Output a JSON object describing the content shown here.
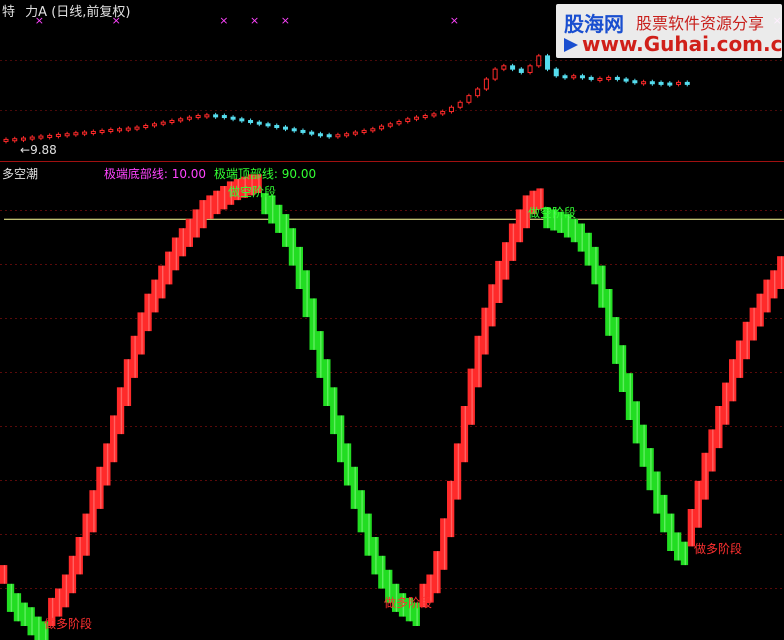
{
  "top_panel": {
    "title_left": "特",
    "title_name": "力A",
    "subtitle": "(日线,前复权)",
    "price_label": "9.88",
    "price_marker": "←"
  },
  "watermark": {
    "brand": "股海网",
    "slogan": "股票软件资源分享",
    "url": "www.Guhai.com.cn"
  },
  "indicator_panel": {
    "name": "多空潮",
    "bottom_line_label": "极端底部线: 10.00",
    "top_line_label": "极端顶部线: 90.00"
  },
  "colors": {
    "background": "#000000",
    "up_bar": "#ff2a2a",
    "down_bar": "#22dd22",
    "top_line": "#ffff99",
    "marker_magenta": "#ff44ff",
    "divider": "#a01010",
    "label_red": "#ff3030",
    "label_green": "#33ff33",
    "cyan": "#55ddee"
  },
  "chart_data": [
    {
      "type": "line",
      "name": "price-panel",
      "description_series": "candlestick prices (approx)",
      "ylim": [
        9.5,
        13.0
      ],
      "labels": [
        "9.88"
      ],
      "series": [
        {
          "values": [
            9.88,
            9.9,
            9.92,
            9.95,
            9.98,
            10.0,
            10.03,
            10.05,
            10.08,
            10.1,
            10.12,
            10.15,
            10.18,
            10.2,
            10.22,
            10.25,
            10.3,
            10.35,
            10.4,
            10.45,
            10.5,
            10.55,
            10.6,
            10.62,
            10.6,
            10.55,
            10.5,
            10.45,
            10.4,
            10.35,
            10.3,
            10.25,
            10.2,
            10.15,
            10.1,
            10.05,
            10.02,
            10.0,
            10.02,
            10.05,
            10.1,
            10.15,
            10.2,
            10.28,
            10.35,
            10.42,
            10.5,
            10.55,
            10.6,
            10.65,
            10.72,
            10.85,
            11.0,
            11.2,
            11.4,
            11.7,
            12.0,
            12.1,
            12.0,
            11.9,
            12.1,
            12.4,
            12.0,
            11.8,
            11.75,
            11.8,
            11.75,
            11.7,
            11.72,
            11.75,
            11.7,
            11.65,
            11.6,
            11.62,
            11.6,
            11.58,
            11.55,
            11.6,
            11.55
          ]
        }
      ]
    },
    {
      "type": "bar",
      "name": "多空潮",
      "ylim": [
        0,
        100
      ],
      "reference_lines": [
        {
          "label": "极端顶部线",
          "value": 90.0
        },
        {
          "label": "极端底部线",
          "value": 10.0
        }
      ],
      "series": [
        {
          "values": [
            12,
            10,
            8,
            7,
            5,
            4,
            3,
            5,
            7,
            10,
            14,
            18,
            23,
            28,
            33,
            38,
            44,
            50,
            56,
            61,
            66,
            70,
            73,
            76,
            79,
            82,
            84,
            86,
            88,
            90,
            91,
            92,
            93,
            94,
            94.5,
            95,
            95.5,
            95.5,
            95,
            93,
            91,
            88,
            84,
            79,
            73,
            66,
            60,
            54,
            48,
            42,
            37,
            32,
            27,
            22,
            18,
            15,
            12,
            10,
            9,
            8,
            7,
            8,
            10,
            15,
            22,
            30,
            38,
            46,
            54,
            61,
            67,
            72,
            77,
            81,
            85,
            88,
            91,
            92,
            92.5,
            92,
            91.5,
            91,
            90,
            89,
            87,
            84,
            80,
            75,
            69,
            63,
            57,
            51,
            46,
            41,
            36,
            31,
            27,
            23,
            21,
            20,
            24,
            30,
            36,
            41,
            46,
            51,
            56,
            60,
            64,
            67,
            70,
            73,
            75,
            78
          ]
        }
      ],
      "annotations": [
        {
          "text": "做空阶段"
        },
        {
          "text": "做多阶段"
        },
        {
          "text": "做空阶段"
        },
        {
          "text": "做多阶段"
        },
        {
          "text": "做多阶段"
        }
      ]
    }
  ]
}
